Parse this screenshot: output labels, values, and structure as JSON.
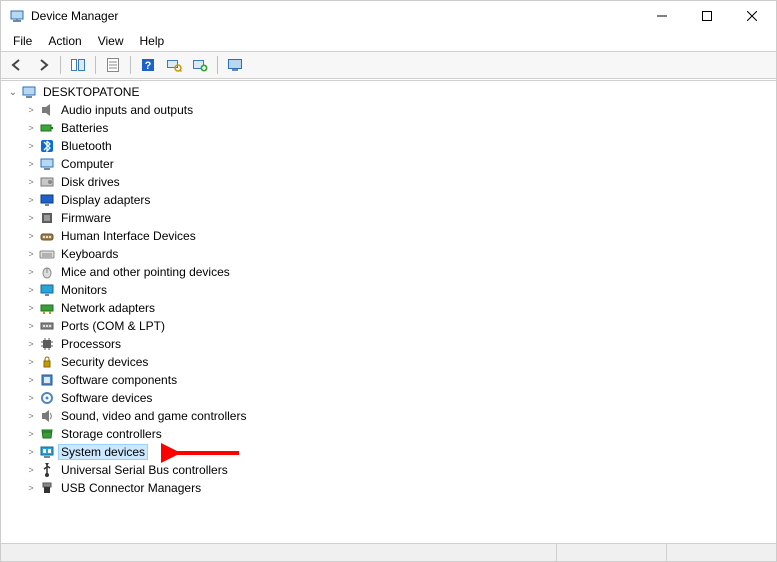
{
  "window": {
    "title": "Device Manager"
  },
  "menu": {
    "items": [
      "File",
      "Action",
      "View",
      "Help"
    ]
  },
  "toolbar": {
    "buttons": [
      {
        "name": "back-icon"
      },
      {
        "name": "forward-icon"
      },
      {
        "name": "show-hide-tree-icon"
      },
      {
        "name": "properties-icon"
      },
      {
        "name": "help-icon"
      },
      {
        "name": "scan-hardware-icon"
      },
      {
        "name": "add-legacy-icon"
      },
      {
        "name": "devices-by-type-icon"
      }
    ]
  },
  "tree": {
    "root": {
      "label": "DESKTOPATONE",
      "expanded": true,
      "icon": "computer-icon"
    },
    "children": [
      {
        "label": "Audio inputs and outputs",
        "icon": "speaker-icon"
      },
      {
        "label": "Batteries",
        "icon": "battery-icon"
      },
      {
        "label": "Bluetooth",
        "icon": "bluetooth-icon"
      },
      {
        "label": "Computer",
        "icon": "pc-icon"
      },
      {
        "label": "Disk drives",
        "icon": "disk-icon"
      },
      {
        "label": "Display adapters",
        "icon": "display-adapter-icon"
      },
      {
        "label": "Firmware",
        "icon": "firmware-icon"
      },
      {
        "label": "Human Interface Devices",
        "icon": "hid-icon"
      },
      {
        "label": "Keyboards",
        "icon": "keyboard-icon"
      },
      {
        "label": "Mice and other pointing devices",
        "icon": "mouse-icon"
      },
      {
        "label": "Monitors",
        "icon": "monitor-icon"
      },
      {
        "label": "Network adapters",
        "icon": "network-icon"
      },
      {
        "label": "Ports (COM & LPT)",
        "icon": "port-icon"
      },
      {
        "label": "Processors",
        "icon": "cpu-icon"
      },
      {
        "label": "Security devices",
        "icon": "security-icon"
      },
      {
        "label": "Software components",
        "icon": "software-comp-icon"
      },
      {
        "label": "Software devices",
        "icon": "software-dev-icon"
      },
      {
        "label": "Sound, video and game controllers",
        "icon": "sound-icon"
      },
      {
        "label": "Storage controllers",
        "icon": "storage-icon"
      },
      {
        "label": "System devices",
        "icon": "system-icon",
        "selected": true
      },
      {
        "label": "Universal Serial Bus controllers",
        "icon": "usb-icon"
      },
      {
        "label": "USB Connector Managers",
        "icon": "usb-connector-icon"
      }
    ]
  },
  "annotation": {
    "color": "#ff0000"
  }
}
